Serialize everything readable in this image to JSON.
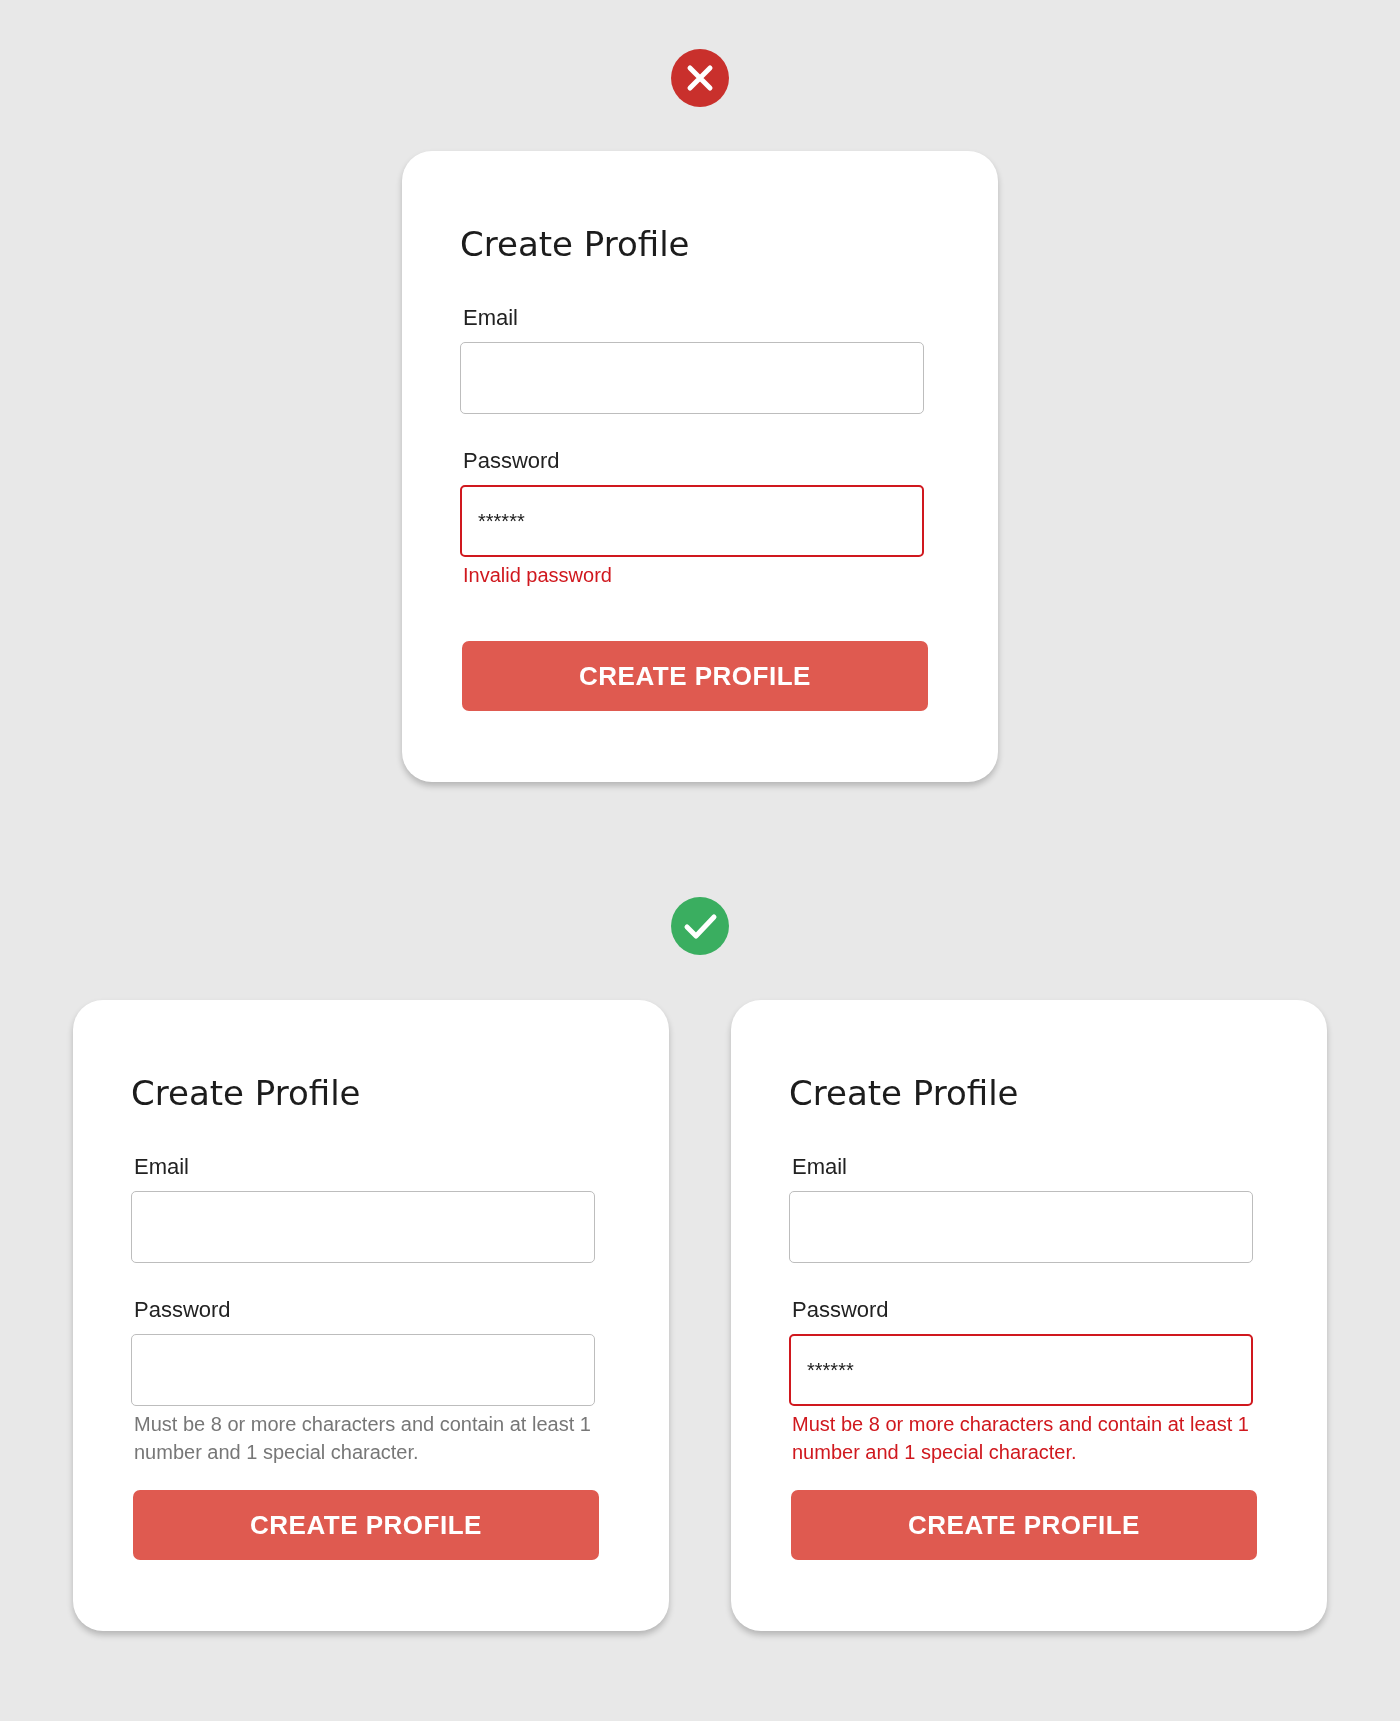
{
  "sections": [
    {
      "kind": "wrong",
      "cards": [
        {
          "title": "Create Profile",
          "fields": [
            {
              "label": "Email",
              "invalid": false
            },
            {
              "label": "Password",
              "value": "******",
              "invalid": true
            }
          ],
          "helper": {
            "text": "Invalid password",
            "error": true
          },
          "button": "CREATE PROFILE"
        }
      ]
    },
    {
      "kind": "right",
      "cards": [
        {
          "title": "Create Profile",
          "fields": [
            {
              "label": "Email",
              "invalid": false
            },
            {
              "label": "Password",
              "invalid": false
            }
          ],
          "helper": {
            "text": "Must be 8 or more characters and contain at least 1 number and 1 special character.",
            "error": false
          },
          "button": "CREATE PROFILE"
        },
        {
          "title": "Create Profile",
          "fields": [
            {
              "label": "Email",
              "invalid": false
            },
            {
              "label": "Password",
              "value": "******",
              "invalid": true
            }
          ],
          "helper": {
            "text": "Must be 8 or more characters and contain at least 1 number and 1 special character.",
            "error": true
          },
          "button": "CREATE PROFILE"
        }
      ]
    }
  ]
}
